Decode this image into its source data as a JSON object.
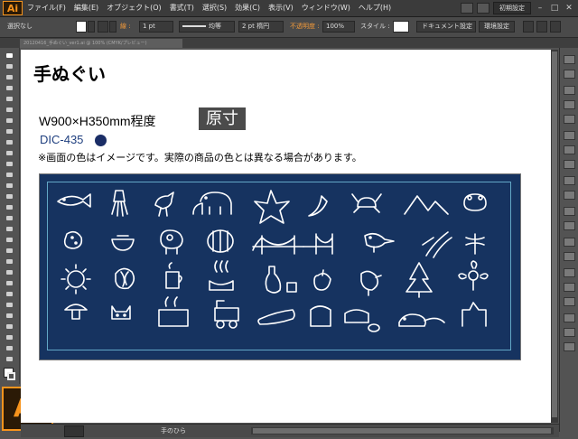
{
  "app": {
    "logo": "Ai"
  },
  "menu": {
    "items": [
      "ファイル(F)",
      "編集(E)",
      "オブジェクト(O)",
      "書式(T)",
      "選択(S)",
      "効果(C)",
      "表示(V)",
      "ウィンドウ(W)",
      "ヘルプ(H)"
    ],
    "workspace": "初期設定"
  },
  "control": {
    "selection": "選択なし",
    "stroke_label": "線 :",
    "stroke_weight": "1 pt",
    "stroke_profile": "均等",
    "brush": "2 pt 楕円",
    "opacity_label": "不透明度 :",
    "opacity": "100%",
    "style_label": "スタイル :",
    "doc_settings": "ドキュメント設定",
    "preferences": "環境設定"
  },
  "tab": {
    "title": "20120416_手ぬぐい_ver1.ai @ 100% (CMYK/プレビュー)"
  },
  "artboard": {
    "title": "手ぬぐい",
    "dimensions": "W900×H350mm程度",
    "badge": "原寸",
    "color_code": "DIC-435",
    "note": "※画面の色はイメージです。実際の商品の色とは異なる場合があります。"
  },
  "colors": {
    "accent": "#f7941d",
    "cloth": "#163360",
    "swatch": "#1a2d66",
    "guide": "#62a7c6"
  },
  "status": {
    "tool": "手のひら"
  }
}
